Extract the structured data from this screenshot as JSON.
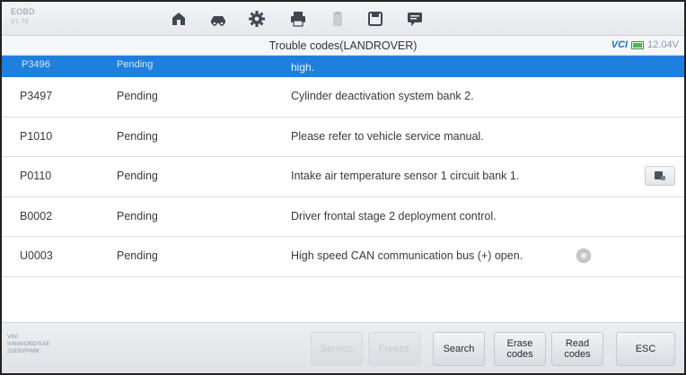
{
  "app": {
    "brand": "EOBD",
    "brand_sub": "V1.70"
  },
  "toolbar": {
    "icons": [
      "home-icon",
      "vehicle-icon",
      "settings-icon",
      "print-icon",
      "clipboard-icon",
      "save-icon",
      "message-icon"
    ]
  },
  "header": {
    "title": "Trouble codes(LANDROVER)",
    "vci_label": "VCI",
    "voltage": "12.04V"
  },
  "selected_row": {
    "code": "P3496",
    "status": "Pending",
    "description": "high."
  },
  "rows": [
    {
      "code": "P3497",
      "status": "Pending",
      "description": "Cylinder deactivation system bank 2."
    },
    {
      "code": "P1010",
      "status": "Pending",
      "description": "Please refer to vehicle service manual."
    },
    {
      "code": "P0110",
      "status": "Pending",
      "description": "Intake air temperature sensor 1 circuit bank 1."
    },
    {
      "code": "B0002",
      "status": "Pending",
      "description": "Driver frontal stage 2 deployment control."
    },
    {
      "code": "U0003",
      "status": "Pending",
      "description": "High speed CAN communication bus (+) open."
    }
  ],
  "footer": {
    "vin_line1": "VIN:",
    "vin_line2": "Infiniti/OBD/SAE",
    "vin_line3": "J1850/PWM",
    "buttons": {
      "service": "Service",
      "freeze": "Freeze",
      "search": "Search",
      "erase_line1": "Erase",
      "erase_line2": "codes",
      "read_line1": "Read",
      "read_line2": "codes",
      "esc": "ESC"
    }
  }
}
